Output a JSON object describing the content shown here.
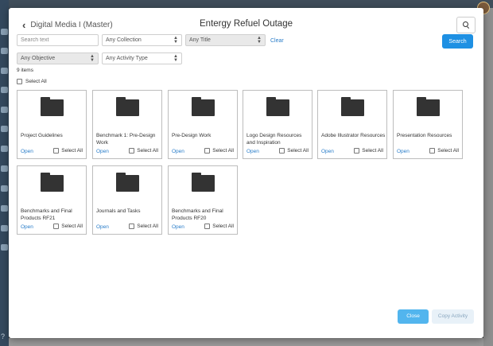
{
  "header": {
    "back_label": "Digital Media I (Master)",
    "title": "Entergy Refuel Outage"
  },
  "filters": {
    "search_placeholder": "Search text",
    "collection": "Any Collection",
    "title": "Any Title",
    "objective": "Any Objective",
    "activity_type": "Any Activity Type",
    "clear_label": "Clear",
    "search_button": "Search"
  },
  "results": {
    "count": "9 items",
    "select_all": "Select All"
  },
  "cards": [
    {
      "title": "Project Guidelines",
      "open": "Open",
      "select": "Select All"
    },
    {
      "title": "Benchmark 1: Pre-Design Work",
      "open": "Open",
      "select": "Select All"
    },
    {
      "title": "Pre-Design Work",
      "open": "Open",
      "select": "Select All"
    },
    {
      "title": "Logo Design Resources and Inspiration",
      "open": "Open",
      "select": "Select All"
    },
    {
      "title": "Adobe Illustrator Resources",
      "open": "Open",
      "select": "Select All"
    },
    {
      "title": "Presentation Resources",
      "open": "Open",
      "select": "Select All"
    },
    {
      "title": "Benchmarks and Final Products RF21",
      "open": "Open",
      "select": "Select All"
    },
    {
      "title": "Journals and Tasks",
      "open": "Open",
      "select": "Select All"
    },
    {
      "title": "Benchmarks and Final Products RF20",
      "open": "Open",
      "select": "Select All"
    }
  ],
  "footer": {
    "close": "Close",
    "copy": "Copy Activity"
  },
  "colors": {
    "primary": "#1e90e3",
    "link": "#2a7dc9",
    "folder": "#333333"
  },
  "background": {
    "help_glyph": "?"
  }
}
